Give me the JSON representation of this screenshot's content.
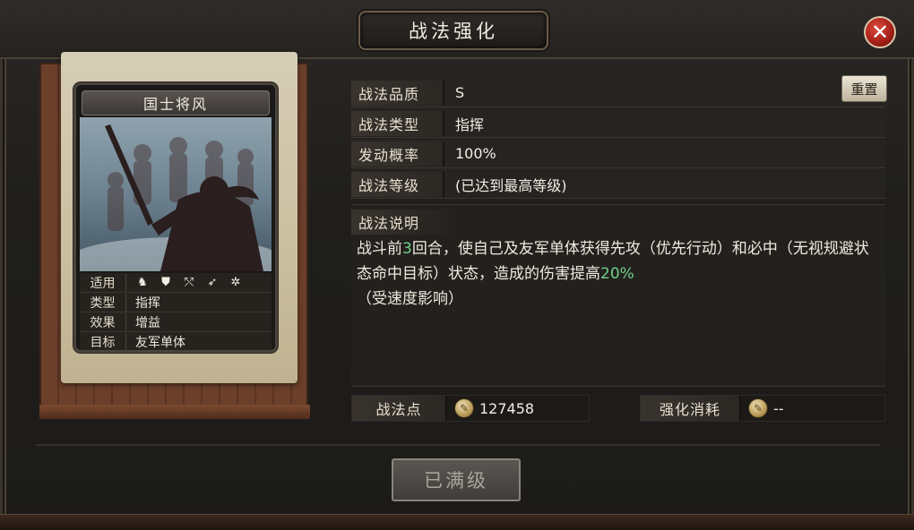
{
  "dialog": {
    "title": "战法强化"
  },
  "card": {
    "name": "国士将风",
    "rows": [
      {
        "key": "适用",
        "value": ""
      },
      {
        "key": "类型",
        "value": "指挥"
      },
      {
        "key": "效果",
        "value": "增益"
      },
      {
        "key": "目标",
        "value": "友军单体"
      }
    ],
    "unit_icons": [
      "cavalry-icon",
      "shield-icon",
      "bow-icon",
      "spear-icon",
      "chariot-icon"
    ]
  },
  "info": {
    "quality_label": "战法品质",
    "quality_value": "S",
    "type_label": "战法类型",
    "type_value": "指挥",
    "rate_label": "发动概率",
    "rate_value": "100%",
    "level_label": "战法等级",
    "level_value": "(已达到最高等级)",
    "reset_label": "重置"
  },
  "description": {
    "title": "战法说明",
    "text_part1": "战斗前",
    "text_hl1": "3",
    "text_part2": "回合，使自己及友军单体获得先攻（优先行动）和必中（无视规避状态命中目标）状态，造成的伤害提高",
    "text_hl2": "20%",
    "text_part3": "（受速度影响）"
  },
  "points": {
    "label": "战法点",
    "value": "127458"
  },
  "cost": {
    "label": "强化消耗",
    "value": "--"
  },
  "button": {
    "label": "已满级"
  },
  "colors": {
    "highlight": "#6fcf8a",
    "close": "#c0281f"
  }
}
